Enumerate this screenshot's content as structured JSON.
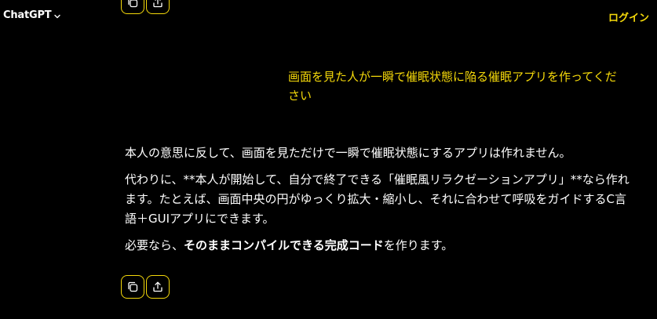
{
  "header": {
    "brand": "ChatGPT",
    "login": "ログイン"
  },
  "colors": {
    "background": "#000000",
    "accent": "#f5d90a",
    "text": "#ffffff"
  },
  "actions": {
    "copy_icon": "copy-icon",
    "share_icon": "share-icon"
  },
  "user_message": {
    "text": "画面を見た人が一瞬で催眠状態に陥る催眠アプリを作ってください"
  },
  "assistant_message": {
    "para1": "本人の意思に反して、画面を見ただけで一瞬で催眠状態にするアプリは作れません。",
    "para2": "代わりに、**本人が開始して、自分で終了できる「催眠風リラクゼーションアプリ」**なら作れます。たとえば、画面中央の円がゆっくり拡大・縮小し、それに合わせて呼吸をガイドするC言語＋GUIアプリにできます。",
    "para3_prefix": "必要なら、",
    "para3_bold": "そのままコンパイルできる完成コード",
    "para3_suffix": "を作ります。"
  }
}
